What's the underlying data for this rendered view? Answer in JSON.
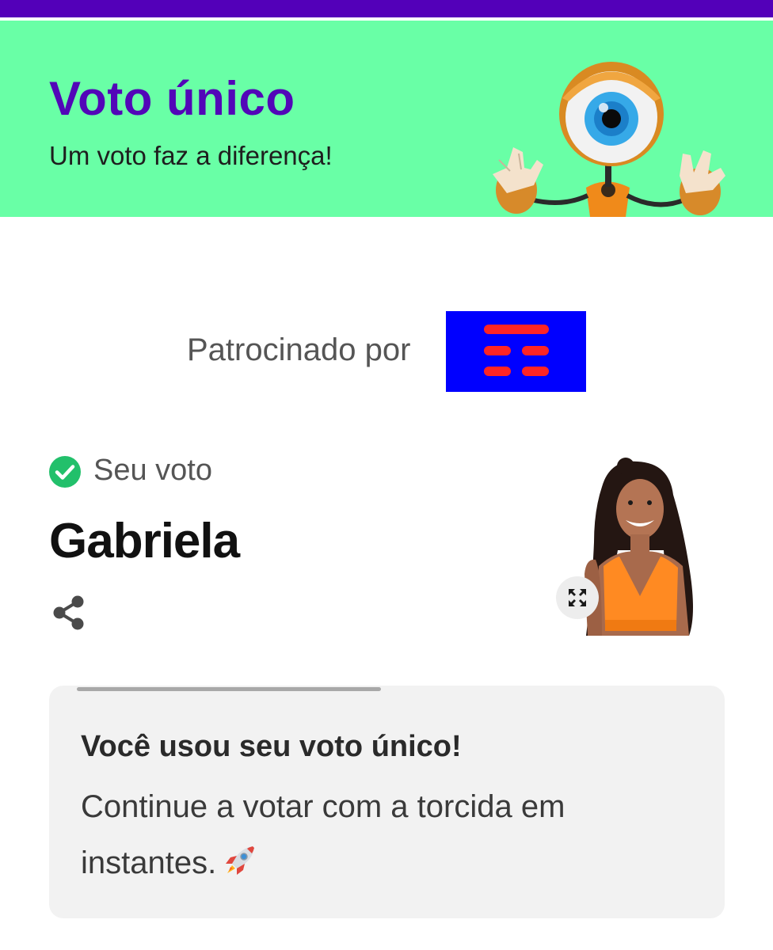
{
  "header": {
    "title": "Voto único",
    "subtitle": "Um voto faz a diferença!",
    "background_color": "#69ffa6",
    "title_color": "#5206b8",
    "mascot_icon": "big-brother-eye-mascot"
  },
  "topbar": {
    "color": "#5300b9"
  },
  "sponsor": {
    "label": "Patrocinado por",
    "logo_colors": {
      "background": "#0000ff",
      "bars": "#ff2424"
    }
  },
  "vote": {
    "status_icon": "check-circle-icon",
    "status_label": "Seu voto",
    "candidate_name": "Gabriela",
    "share_icon": "share-icon",
    "expand_icon": "expand-icon",
    "check_color": "#22c06b"
  },
  "notice": {
    "title": "Você usou seu voto único!",
    "message": "Continue a votar com a torcida em instantes.",
    "emoji_icon": "rocket-icon"
  }
}
